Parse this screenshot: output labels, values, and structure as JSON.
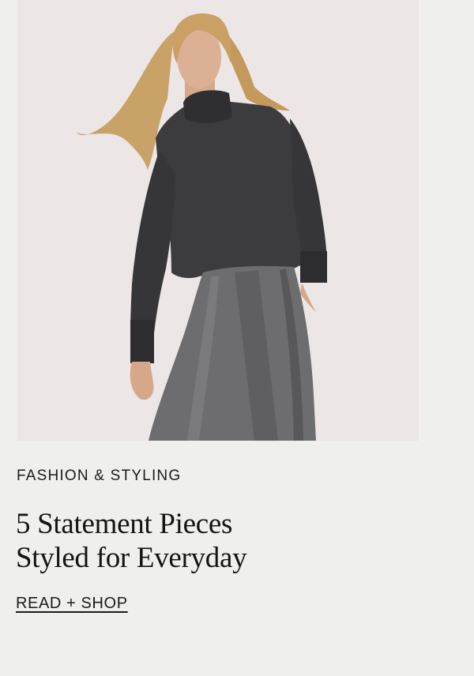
{
  "article": {
    "category": "FASHION & STYLING",
    "headline_line1": "5 Statement Pieces",
    "headline_line2": "Styled for Everyday",
    "cta_label": "READ + SHOP"
  },
  "image": {
    "subject": "woman-in-charcoal-turtleneck-and-grey-trousers",
    "background_color": "#ece6e6"
  },
  "colors": {
    "page_background": "#efefed",
    "text": "#1b1b1b"
  }
}
